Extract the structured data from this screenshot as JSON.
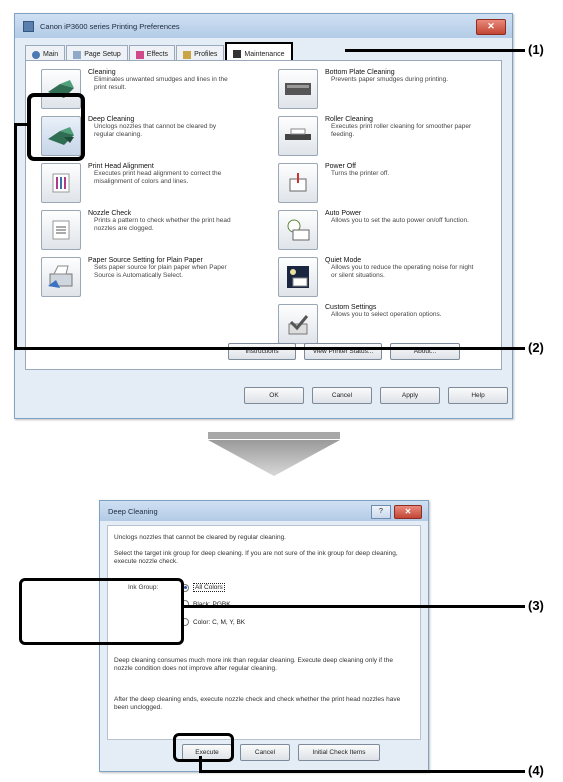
{
  "window": {
    "title": "Canon iP3600 series Printing Preferences",
    "tabs": [
      "Main",
      "Page Setup",
      "Effects",
      "Profiles",
      "Maintenance"
    ],
    "active_tab": "Maintenance",
    "left_items": [
      {
        "name": "Cleaning",
        "desc": "Eliminates unwanted smudges and lines in the print result."
      },
      {
        "name": "Deep Cleaning",
        "desc": "Unclogs nozzles that cannot be cleared by regular cleaning."
      },
      {
        "name": "Print Head Alignment",
        "desc": "Executes print head alignment to correct the misalignment of colors and lines."
      },
      {
        "name": "Nozzle Check",
        "desc": "Prints a pattern to check whether the print head nozzles are clogged."
      },
      {
        "name": "Paper Source Setting for Plain Paper",
        "desc": "Sets paper source for plain paper when Paper Source is Automatically Select."
      }
    ],
    "right_items": [
      {
        "name": "Bottom Plate Cleaning",
        "desc": "Prevents paper smudges during printing."
      },
      {
        "name": "Roller Cleaning",
        "desc": "Executes print roller cleaning for smoother paper feeding."
      },
      {
        "name": "Power Off",
        "desc": "Turns the printer off."
      },
      {
        "name": "Auto Power",
        "desc": "Allows you to set the auto power on/off function."
      },
      {
        "name": "Quiet Mode",
        "desc": "Allows you to reduce the operating noise for night or silent situations."
      },
      {
        "name": "Custom Settings",
        "desc": "Allows you to select operation options."
      }
    ],
    "panel_buttons": [
      "Instructions",
      "View Printer Status...",
      "About..."
    ],
    "dialog_buttons": [
      "OK",
      "Cancel",
      "Apply",
      "Help"
    ]
  },
  "dialog": {
    "title": "Deep Cleaning",
    "help": "?",
    "intro": "Unclogs nozzles that cannot be cleared by regular cleaning.",
    "select_text": "Select the target ink group for deep cleaning. If you are not sure of the ink group for deep cleaning, execute nozzle check.",
    "ink_group_label": "Ink Group:",
    "options": [
      {
        "label": "All Colors",
        "selected": true
      },
      {
        "label": "Black:  PGBK",
        "selected": false
      },
      {
        "label": "Color:  C, M, Y, BK",
        "selected": false
      }
    ],
    "warning": "Deep cleaning consumes much more ink than regular cleaning. Execute deep cleaning only if the nozzle condition does not improve after regular cleaning.",
    "after": "After the deep cleaning ends, execute nozzle check and check whether the print head nozzles have been unclogged.",
    "buttons": [
      "Execute",
      "Cancel",
      "Initial Check Items"
    ]
  },
  "callouts": [
    "(1)",
    "(2)",
    "(3)",
    "(4)"
  ]
}
